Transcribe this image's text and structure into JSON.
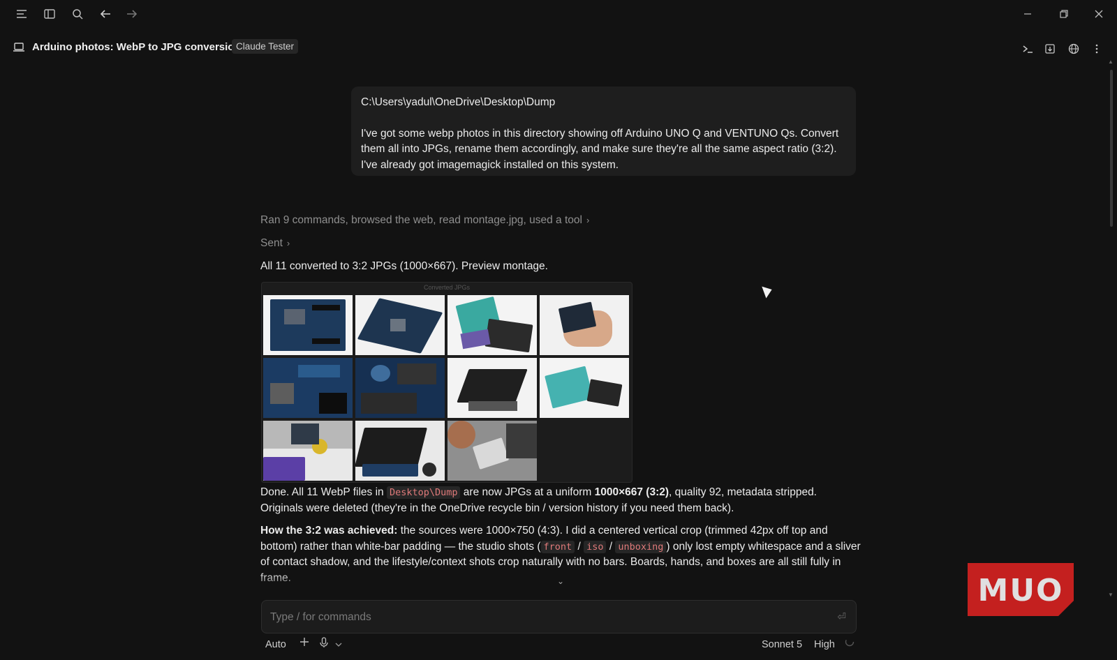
{
  "toolbar": {
    "icons": [
      "menu-icon",
      "sidebar-toggle-icon",
      "search-icon",
      "back-arrow-icon",
      "forward-arrow-icon"
    ],
    "window_controls": [
      "minimize-icon",
      "restore-icon",
      "close-icon"
    ]
  },
  "header": {
    "title": "Arduino photos: WebP to JPG conversion",
    "tag": "Claude Tester",
    "right_icons": [
      "terminal-icon",
      "export-icon",
      "globe-icon",
      "more-vertical-icon"
    ]
  },
  "user_message": {
    "path": "C:\\Users\\yadul\\OneDrive\\Desktop\\Dump",
    "body": "I've got some webp photos in this directory showing off Arduino UNO Q and VENTUNO Qs. Convert them all into JPGs, rename them accordingly, and make sure they're all the same aspect ratio (3:2). I've already got imagemagick installed on this system."
  },
  "assistant": {
    "activity": "Ran 9 commands, browsed the web, read montage.jpg, used a tool",
    "sent": "Sent",
    "summary": "All 11 converted to 3:2 JPGs (1000×667). Preview montage.",
    "montage_title": "Converted JPGs",
    "para1": {
      "t1": "Done. All 11 WebP files in ",
      "code1": "Desktop\\Dump",
      "t2": " are now JPGs at a uniform ",
      "bold1": "1000×667 (3:2)",
      "t3": ", quality 92, metadata stripped. Originals were deleted (they're in the OneDrive recycle bin / version history if you need them back)."
    },
    "para2": {
      "bold1": "How the 3:2 was achieved:",
      "t1": " the sources were 1000×750 (4:3). I did a centered vertical crop (trimmed 42px off top and bottom) rather than white-bar padding — the studio shots (",
      "code1": "front",
      "sep1": " / ",
      "code2": "iso",
      "sep2": " / ",
      "code3": "unboxing",
      "t2": ") only lost empty whitespace and a sliver of contact shadow, and the lifestyle/context shots crop naturally with no bars. Boards, hands, and boxes are all still fully in frame."
    }
  },
  "composer": {
    "placeholder": "Type / for commands"
  },
  "footer": {
    "mode": "Auto",
    "model": "Sonnet 5",
    "effort": "High"
  },
  "watermark": "MUO",
  "colors": {
    "background": "#121212",
    "bubble": "#1e1e1e",
    "code_text": "#e07a7a",
    "logo_red": "#c4201f"
  }
}
